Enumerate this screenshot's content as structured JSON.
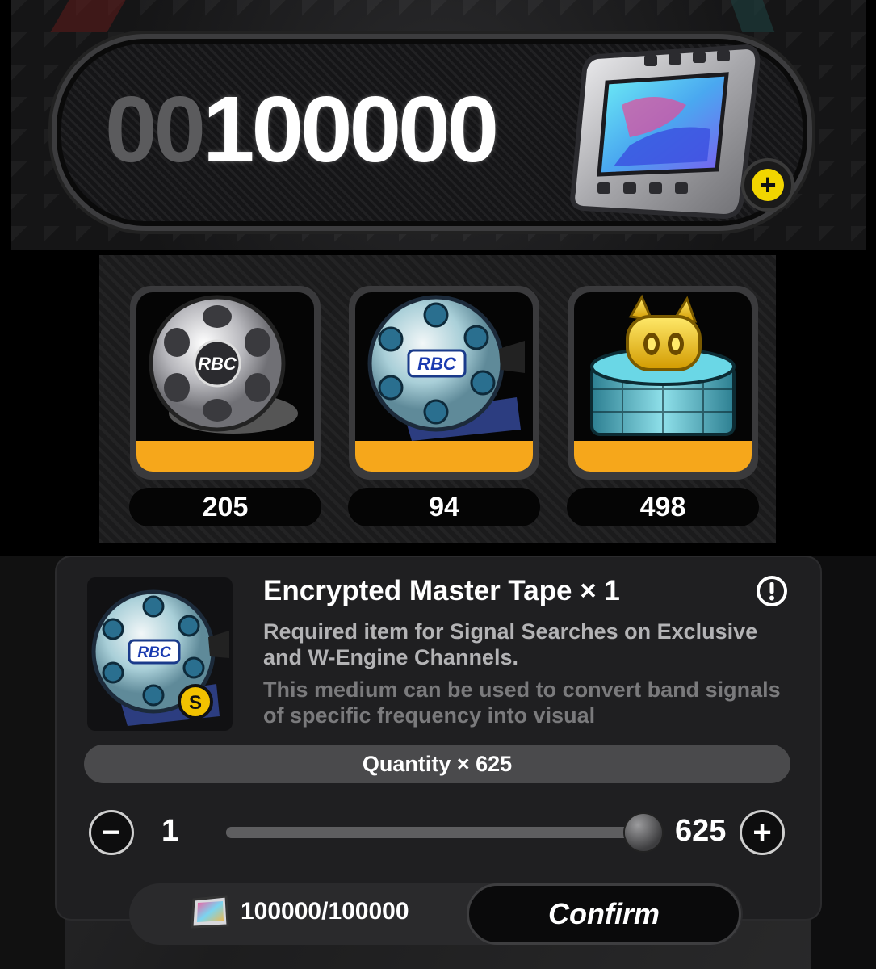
{
  "currency": {
    "leading_zeros": "00",
    "value": "100000",
    "icon": "film-ticket-icon",
    "add_icon": "plus-icon"
  },
  "items": [
    {
      "icon": "silver-film-reel-icon",
      "count": "205"
    },
    {
      "icon": "encrypted-master-tape-icon",
      "count": "94"
    },
    {
      "icon": "bangboo-signal-icon",
      "count": "498"
    }
  ],
  "dialog": {
    "title": "Encrypted Master Tape × 1",
    "description_primary": "Required item for Signal Searches on Exclusive and W-Engine Channels.",
    "description_secondary": "This medium can be used to convert band signals of specific frequency into visual",
    "quantity_label": "Quantity × 625",
    "min": "1",
    "max": "625",
    "slider_fraction": 1.0,
    "cost": "100000/100000",
    "confirm_label": "Confirm",
    "info_icon": "info-icon"
  },
  "colors": {
    "rarity": "#f6a71b",
    "currency_add": "#f2d500"
  }
}
